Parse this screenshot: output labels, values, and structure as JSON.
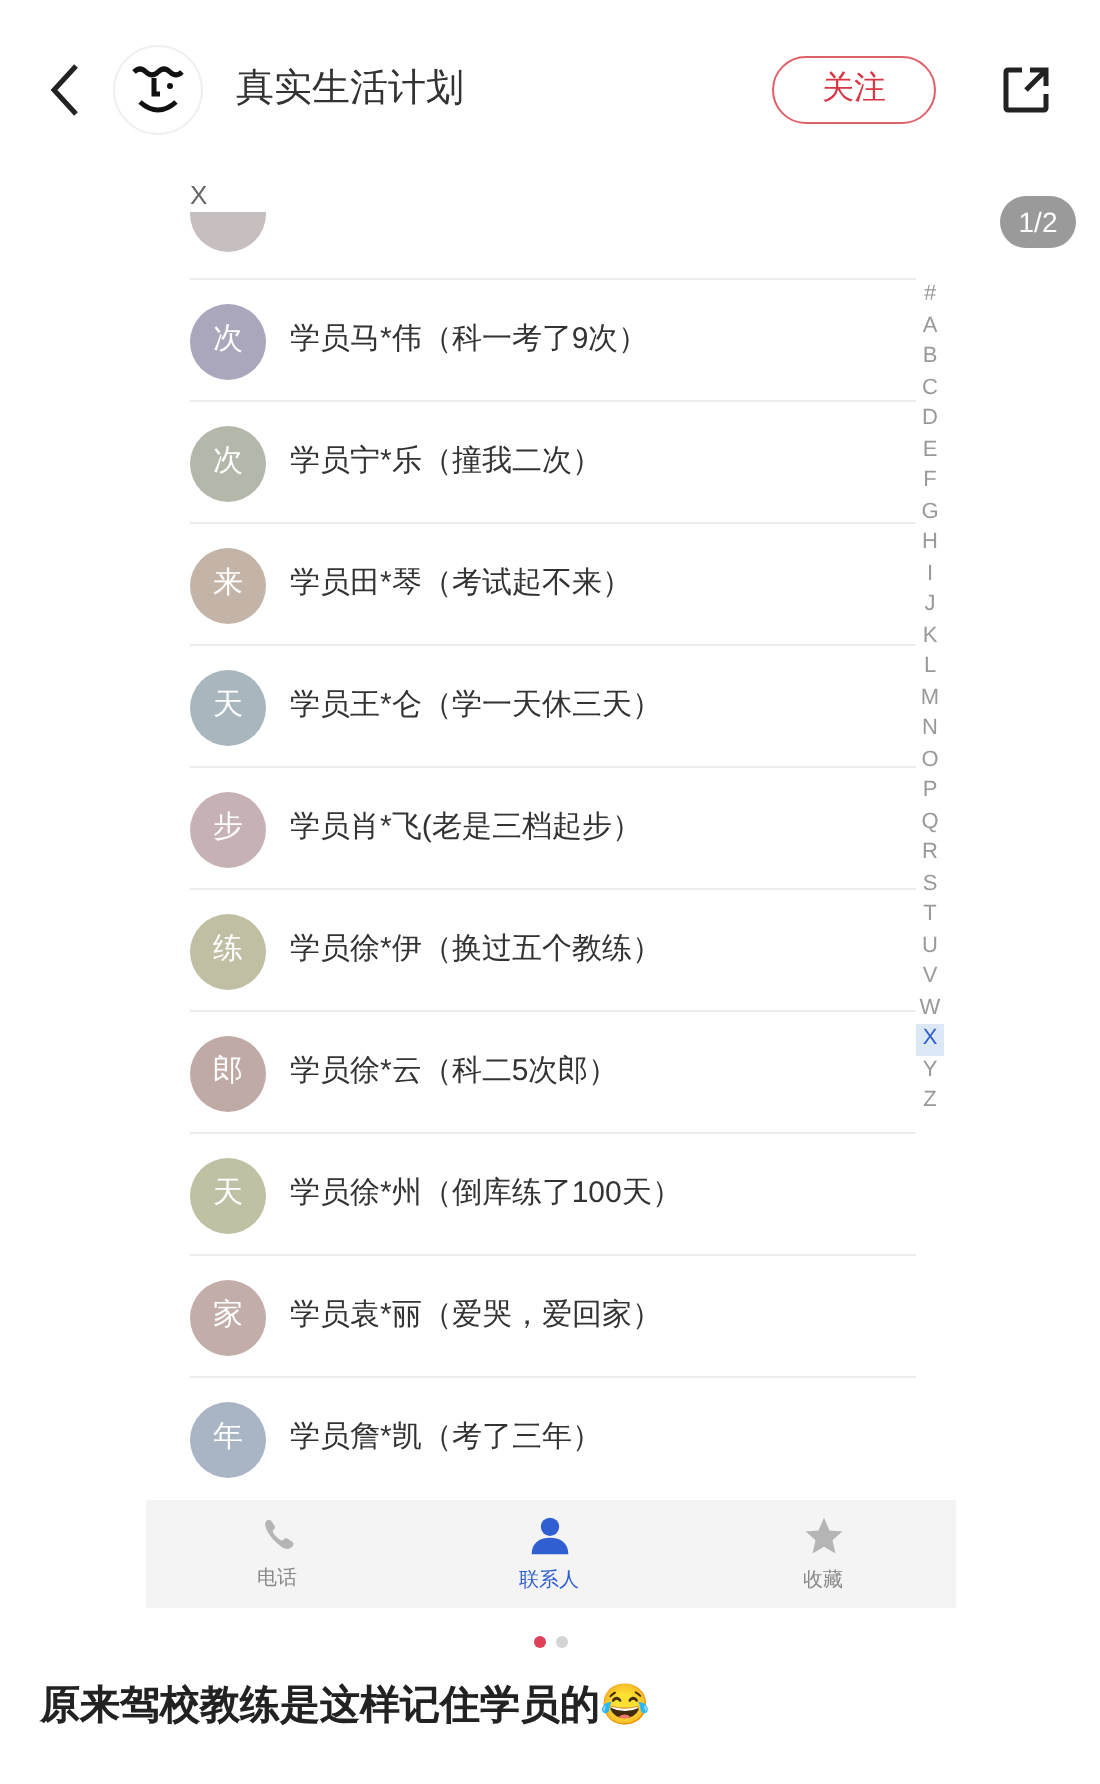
{
  "header": {
    "author": "真实生活计划",
    "follow_button": "关注"
  },
  "page_counter": "1/2",
  "contacts_screen": {
    "section_letter": "X",
    "contacts": [
      {
        "avatar": "次",
        "name": "学员马*伟（科一考了9次）",
        "color": "#aaa6bb"
      },
      {
        "avatar": "次",
        "name": "学员宁*乐（撞我二次）",
        "color": "#b3b8ab"
      },
      {
        "avatar": "来",
        "name": "学员田*琴（考试起不来）",
        "color": "#c4b4a8"
      },
      {
        "avatar": "天",
        "name": "学员王*仑（学一天休三天）",
        "color": "#a9b6bd"
      },
      {
        "avatar": "步",
        "name": "学员肖*飞(老是三档起步）",
        "color": "#c6b2b5"
      },
      {
        "avatar": "练",
        "name": "学员徐*伊（换过五个教练）",
        "color": "#c0bea3"
      },
      {
        "avatar": "郎",
        "name": "学员徐*云（科二5次郎）",
        "color": "#bfaaa6"
      },
      {
        "avatar": "天",
        "name": "学员徐*州（倒库练了100天）",
        "color": "#bfc1a4"
      },
      {
        "avatar": "家",
        "name": "学员袁*丽（爱哭，爱回家）",
        "color": "#c2ada9"
      },
      {
        "avatar": "年",
        "name": "学员詹*凯（考了三年）",
        "color": "#a9b5c4"
      }
    ],
    "index": [
      {
        "label": "#",
        "selected": false
      },
      {
        "label": "A",
        "selected": false
      },
      {
        "label": "B",
        "selected": false
      },
      {
        "label": "C",
        "selected": false
      },
      {
        "label": "D",
        "selected": false
      },
      {
        "label": "E",
        "selected": false
      },
      {
        "label": "F",
        "selected": false
      },
      {
        "label": "G",
        "selected": false
      },
      {
        "label": "H",
        "selected": false
      },
      {
        "label": "I",
        "selected": false
      },
      {
        "label": "J",
        "selected": false
      },
      {
        "label": "K",
        "selected": false
      },
      {
        "label": "L",
        "selected": false
      },
      {
        "label": "M",
        "selected": false
      },
      {
        "label": "N",
        "selected": false
      },
      {
        "label": "O",
        "selected": false
      },
      {
        "label": "P",
        "selected": false
      },
      {
        "label": "Q",
        "selected": false
      },
      {
        "label": "R",
        "selected": false
      },
      {
        "label": "S",
        "selected": false
      },
      {
        "label": "T",
        "selected": false
      },
      {
        "label": "U",
        "selected": false
      },
      {
        "label": "V",
        "selected": false
      },
      {
        "label": "W",
        "selected": false
      },
      {
        "label": "X",
        "selected": true
      },
      {
        "label": "Y",
        "selected": false
      },
      {
        "label": "Z",
        "selected": false
      }
    ],
    "tabs": [
      {
        "kind": "phone",
        "label": "电话",
        "selected": false
      },
      {
        "kind": "contacts",
        "label": "联系人",
        "selected": true
      },
      {
        "kind": "favorites",
        "label": "收藏",
        "selected": false
      }
    ]
  },
  "carousel": {
    "dots": [
      {
        "selected": true
      },
      {
        "selected": false
      }
    ]
  },
  "caption": "原来驾校教练是这样记住学员的😂"
}
